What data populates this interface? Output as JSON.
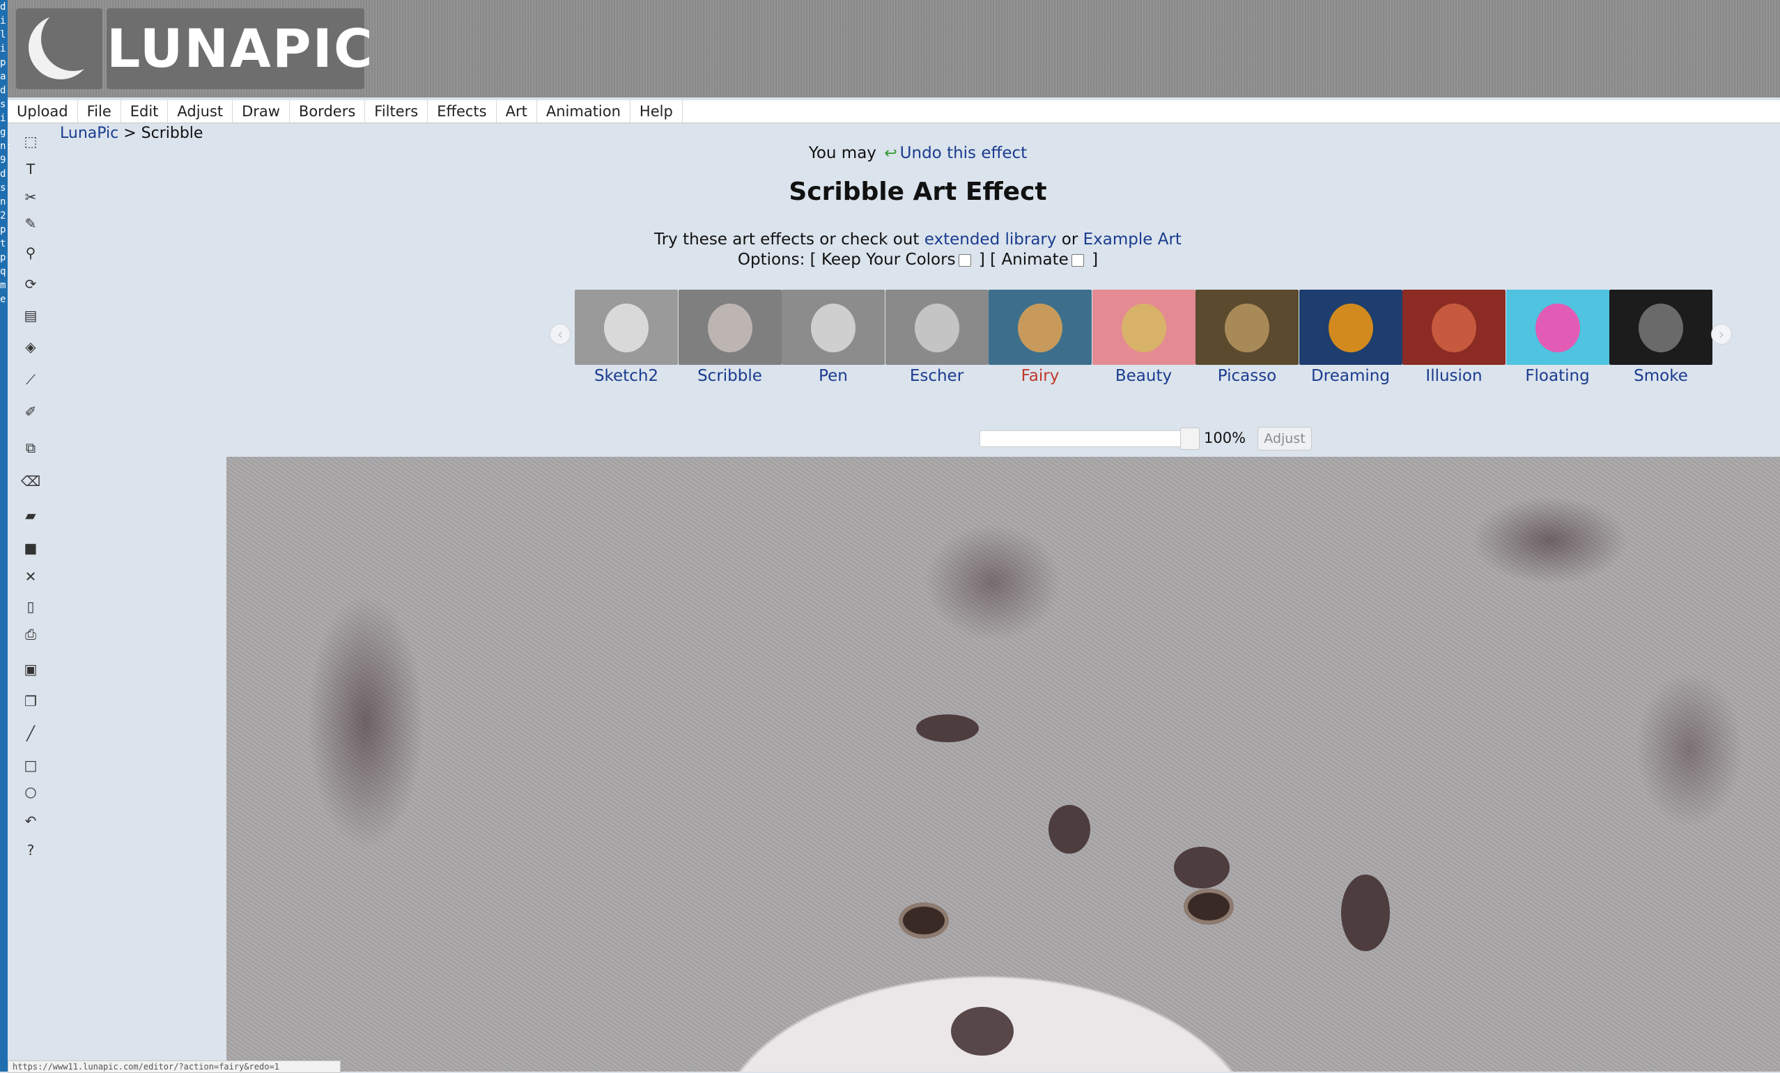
{
  "desktop_strip": {
    "chars": "dilipadsign:9dsn2ptpqme"
  },
  "logo": {
    "text": "LUNAPIC"
  },
  "menu": [
    {
      "label": "Upload"
    },
    {
      "label": "File"
    },
    {
      "label": "Edit"
    },
    {
      "label": "Adjust"
    },
    {
      "label": "Draw"
    },
    {
      "label": "Borders"
    },
    {
      "label": "Filters"
    },
    {
      "label": "Effects"
    },
    {
      "label": "Art"
    },
    {
      "label": "Animation"
    },
    {
      "label": "Help"
    }
  ],
  "breadcrumb": {
    "root": "LunaPic",
    "separator": " > ",
    "current": "Scribble"
  },
  "undo": {
    "prefix": "You may ",
    "link": "Undo this effect"
  },
  "title": "Scribble Art Effect",
  "try_line": {
    "text": "Try these art effects or check out ",
    "link1": "extended library",
    "middle": " or ",
    "link2": "Example Art"
  },
  "options": {
    "prefix": "Options: [ ",
    "keep_colors": "Keep Your Colors",
    "mid": " ] [ ",
    "animate": "Animate",
    "suffix": " ]"
  },
  "effects": [
    {
      "label": "Sketch2",
      "bg": "#9a9a9a",
      "cat": "#d9d9d9"
    },
    {
      "label": "Scribble",
      "bg": "#7f7f7f",
      "cat": "#bdb5b2"
    },
    {
      "label": "Pen",
      "bg": "#8c8c8c",
      "cat": "#cfcfcf"
    },
    {
      "label": "Escher",
      "bg": "#8a8a8a",
      "cat": "#c4c4c4"
    },
    {
      "label": "Fairy",
      "bg": "#3d6f8c",
      "cat": "#c79a5c",
      "active": true
    },
    {
      "label": "Beauty",
      "bg": "#e48a93",
      "cat": "#d9b26a"
    },
    {
      "label": "Picasso",
      "bg": "#5b4a2e",
      "cat": "#a88a58"
    },
    {
      "label": "Dreaming",
      "bg": "#1d3e6e",
      "cat": "#d28a1e"
    },
    {
      "label": "Illusion",
      "bg": "#8b2b24",
      "cat": "#c75a3e"
    },
    {
      "label": "Floating",
      "bg": "#4fc3e0",
      "cat": "#e25bb4"
    },
    {
      "label": "Smoke",
      "bg": "#1c1c1c",
      "cat": "#6a6a6a"
    }
  ],
  "slider": {
    "value_fraction": 1.0,
    "value_text": "100%",
    "button": "Adjust"
  },
  "status_bar": {
    "url": "https://www11.lunapic.com/editor/?action=fairy&redo=1"
  },
  "tools": [
    "marquee-icon",
    "text-icon",
    "scissors-icon",
    "pencil-icon",
    "zoom-icon",
    "rotate-icon",
    "layer-icon",
    "paint-bucket-icon",
    "eyedropper-icon",
    "brush-icon",
    "crop-icon",
    "eraser-icon",
    "open-folder-icon",
    "save-icon",
    "close-icon",
    "new-page-icon",
    "print-icon",
    "paste-icon",
    "copy-icon",
    "line-icon",
    "rectangle-icon",
    "circle-icon",
    "undo-icon",
    "help-icon"
  ]
}
